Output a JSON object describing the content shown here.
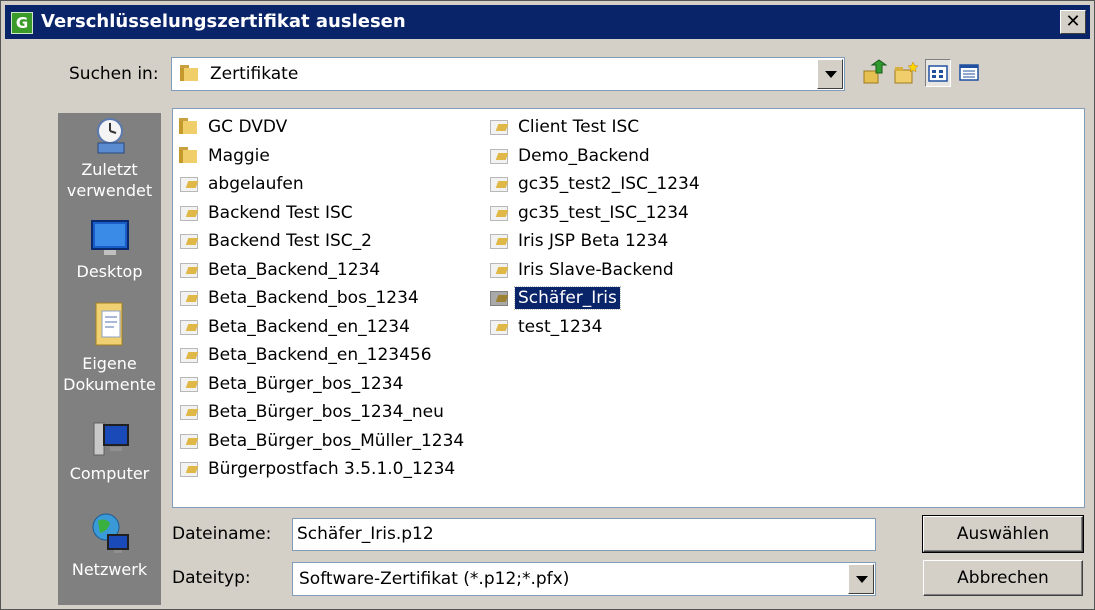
{
  "window": {
    "title": "Verschlüsselungszertifikat auslesen",
    "app_icon_letter": "G",
    "close_glyph": "✕"
  },
  "toolbar": {
    "lookin_label": "Suchen in:",
    "lookin_value": "Zertifikate",
    "buttons": [
      "up-one-level-icon",
      "new-folder-icon",
      "list-view-icon",
      "details-view-icon"
    ]
  },
  "places": [
    {
      "label": "Zuletzt verwendet",
      "icon": "recent-icon"
    },
    {
      "label": "Desktop",
      "icon": "desktop-icon"
    },
    {
      "label": "Eigene Dokumente",
      "icon": "documents-icon"
    },
    {
      "label": "Computer",
      "icon": "computer-icon"
    },
    {
      "label": "Netzwerk",
      "icon": "network-icon"
    }
  ],
  "files": {
    "column1": [
      {
        "name": "GC DVDV",
        "type": "folder"
      },
      {
        "name": "Maggie",
        "type": "folder"
      },
      {
        "name": "abgelaufen",
        "type": "cert"
      },
      {
        "name": "Backend Test ISC",
        "type": "cert"
      },
      {
        "name": "Backend Test ISC_2",
        "type": "cert"
      },
      {
        "name": "Beta_Backend_1234",
        "type": "cert"
      },
      {
        "name": "Beta_Backend_bos_1234",
        "type": "cert"
      },
      {
        "name": "Beta_Backend_en_1234",
        "type": "cert"
      },
      {
        "name": "Beta_Backend_en_123456",
        "type": "cert"
      },
      {
        "name": "Beta_Bürger_bos_1234",
        "type": "cert"
      },
      {
        "name": "Beta_Bürger_bos_1234_neu",
        "type": "cert"
      },
      {
        "name": "Beta_Bürger_bos_Müller_1234",
        "type": "cert"
      },
      {
        "name": "Bürgerpostfach 3.5.1.0_1234",
        "type": "cert"
      }
    ],
    "column2": [
      {
        "name": "Client Test ISC",
        "type": "cert"
      },
      {
        "name": "Demo_Backend",
        "type": "cert"
      },
      {
        "name": "gc35_test2_ISC_1234",
        "type": "cert"
      },
      {
        "name": "gc35_test_ISC_1234",
        "type": "cert"
      },
      {
        "name": "Iris JSP Beta 1234",
        "type": "cert"
      },
      {
        "name": "Iris Slave-Backend",
        "type": "cert"
      },
      {
        "name": "Schäfer_Iris",
        "type": "cert",
        "selected": true
      },
      {
        "name": "test_1234",
        "type": "cert"
      }
    ]
  },
  "form": {
    "filename_label": "Dateiname:",
    "filename_value": "Schäfer_Iris.p12",
    "filetype_label": "Dateityp:",
    "filetype_value": "Software-Zertifikat (*.p12;*.pfx)"
  },
  "buttons": {
    "select": "Auswählen",
    "cancel": "Abbrechen"
  },
  "colors": {
    "titlebar": "#0a246a",
    "selection": "#0a246a",
    "places_bar": "#808080",
    "face": "#d4d0c8"
  }
}
